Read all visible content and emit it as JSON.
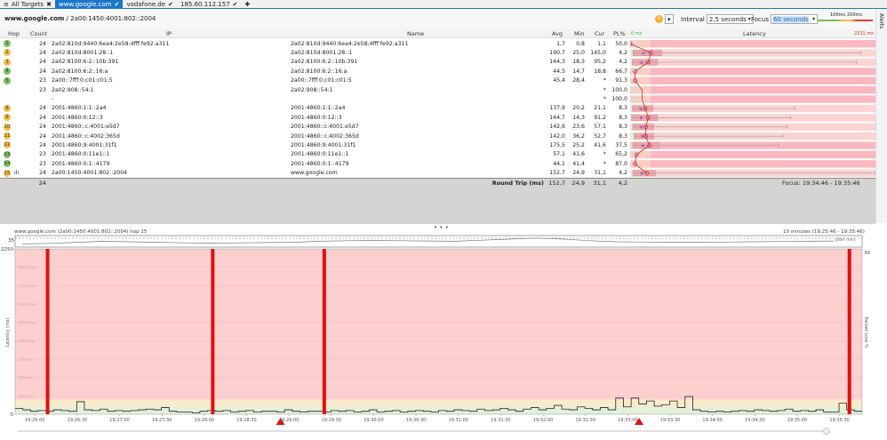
{
  "tabs": [
    {
      "label": "All Targets",
      "icon": "list-icon"
    },
    {
      "label": "www.google.com",
      "active": true
    },
    {
      "label": "vodafone.de"
    },
    {
      "label": "185.60.112.157"
    }
  ],
  "breadcrumb": {
    "host": "www.google.com",
    "path": "/ 2a00:1450:4001:802::2004"
  },
  "toolbar": {
    "interval_label": "Interval",
    "interval_value": "2,5 seconds",
    "focus_label": "Focus",
    "focus_value": "60 seconds",
    "scale_100": "100ms",
    "scale_200": "200ms",
    "alerts": "Alerts"
  },
  "columns": {
    "hop": "Hop",
    "count": "Count",
    "ip": "IP",
    "name": "Name",
    "avg": "Avg",
    "min": "Min",
    "cur": "Cur",
    "pl": "PL%",
    "latency": "Latency",
    "lat_min": "0 ms",
    "lat_max": "2231 ms"
  },
  "rows": [
    {
      "hop": "1",
      "status": "green",
      "count": "24",
      "ip": "2a02:810d:9440:6ea4:2e58:4fff:fe92:a311",
      "name": "2a02:810d:9440:6ea4:2e58:4fff:fe92:a311",
      "avg": "1,7",
      "min": "0,8",
      "cur": "1,1",
      "pl": "50,0",
      "a": 1.7,
      "mn": 0.8,
      "mx": 0,
      "plv": 50
    },
    {
      "hop": "2",
      "status": "orange",
      "count": "24",
      "ip": "2a02:810d:8001:28::1",
      "name": "2a02:810d:8001:28::1",
      "avg": "190,7",
      "min": "25,0",
      "cur": "145,0",
      "pl": "4,2",
      "a": 190.7,
      "mn": 25,
      "mx": 2100,
      "plv": 4.2
    },
    {
      "hop": "3",
      "status": "orange",
      "count": "24",
      "ip": "2a02:8100:6:2::10b:391",
      "name": "2a02:8100:6:2::10b:391",
      "avg": "164,3",
      "min": "18,3",
      "cur": "95,2",
      "pl": "4,2",
      "a": 164.3,
      "mn": 18.3,
      "mx": 2060,
      "plv": 4.2
    },
    {
      "hop": "4",
      "status": "green",
      "count": "24",
      "ip": "2a02:8100:6:2::16:a",
      "name": "2a02:8100:6:2::16:a",
      "avg": "44,5",
      "min": "14,7",
      "cur": "18,8",
      "pl": "66,7",
      "a": 44.5,
      "mn": 14.7,
      "mx": 0,
      "plv": 66.7
    },
    {
      "hop": "5",
      "status": "green",
      "count": "23",
      "ip": "2a00::7fff:0:c01:c01:5",
      "name": "2a00::7fff:0:c01:c01:5",
      "avg": "45,4",
      "min": "28,4",
      "cur": "*",
      "pl": "91,3",
      "a": 45.4,
      "mn": 28.4,
      "mx": 0,
      "plv": 91.3
    },
    {
      "hop": "",
      "status": "",
      "count": "23",
      "ip": "2a02:908::54:1",
      "name": "2a02:908::54:1",
      "avg": "",
      "min": "",
      "cur": "*",
      "pl": "100,0",
      "a": 0,
      "mn": 0,
      "mx": 0,
      "plv": 100
    },
    {
      "hop": "",
      "status": "",
      "count": "",
      "ip": "-",
      "name": "",
      "avg": "",
      "min": "",
      "cur": "*",
      "pl": "100,0",
      "a": 0,
      "mn": 0,
      "mx": 0,
      "plv": 100
    },
    {
      "hop": "8",
      "status": "orange",
      "count": "24",
      "ip": "2001:4860:1:1::2a4",
      "name": "2001:4860:1:1::2a4",
      "avg": "137,9",
      "min": "20,2",
      "cur": "21,1",
      "pl": "8,3",
      "a": 137.9,
      "mn": 20.2,
      "mx": 1500,
      "plv": 8.3
    },
    {
      "hop": "9",
      "status": "orange",
      "count": "24",
      "ip": "2001:4860:0:12::3",
      "name": "2001:4860:0:12::3",
      "avg": "164,7",
      "min": "14,3",
      "cur": "91,2",
      "pl": "8,3",
      "a": 164.7,
      "mn": 14.3,
      "mx": 1460,
      "plv": 8.3
    },
    {
      "hop": "10",
      "status": "orange",
      "count": "24",
      "ip": "2001:4860::c:4001:e5d7",
      "name": "2001:4860::c:4001:e5d7",
      "avg": "142,6",
      "min": "23,6",
      "cur": "57,1",
      "pl": "8,3",
      "a": 142.6,
      "mn": 23.6,
      "mx": 1430,
      "plv": 8.3
    },
    {
      "hop": "11",
      "status": "orange",
      "count": "24",
      "ip": "2001:4860::c:4002:365d",
      "name": "2001:4860::c:4002:365d",
      "avg": "142,0",
      "min": "36,2",
      "cur": "52,7",
      "pl": "8,3",
      "a": 142,
      "mn": 36.2,
      "mx": 1390,
      "plv": 8.3
    },
    {
      "hop": "12",
      "status": "orange",
      "count": "24",
      "ip": "2001:4860:9:4001:31f1",
      "name": "2001:4860:9:4001:31f1",
      "avg": "175,5",
      "min": "25,2",
      "cur": "41,6",
      "pl": "37,5",
      "a": 175.5,
      "mn": 25.2,
      "mx": 1350,
      "plv": 37.5
    },
    {
      "hop": "13",
      "status": "green",
      "count": "23",
      "ip": "2001:4860:0:11e1::1",
      "name": "2001:4860:0:11e1::1",
      "avg": "57,1",
      "min": "41,6",
      "cur": "*",
      "pl": "65,2",
      "a": 57.1,
      "mn": 41.6,
      "mx": 0,
      "plv": 65.2
    },
    {
      "hop": "14",
      "status": "green",
      "count": "23",
      "ip": "2001:4860:0:1::4179",
      "name": "2001:4860:0:1::4179",
      "avg": "44,1",
      "min": "41,4",
      "cur": "*",
      "pl": "87,0",
      "a": 44.1,
      "mn": 41.4,
      "mx": 0,
      "plv": 87
    },
    {
      "hop": "15",
      "status": "orange",
      "count": "24",
      "ip": "2a00:1450:4001:802::2004",
      "name": "www.google.com",
      "avg": "152,7",
      "min": "24,9",
      "cur": "31,1",
      "pl": "4,2",
      "a": 152.7,
      "mn": 24.9,
      "mx": 2230,
      "plv": 4.2
    }
  ],
  "roundtrip": {
    "count": "24",
    "label": "Round Trip (ms)",
    "avg": "152,7",
    "min": "24,9",
    "cur": "31,1",
    "pl": "4,2",
    "focus": "Focus: 19:34:46 - 19:35:46"
  },
  "colors": {
    "green": "#6ab04c",
    "orange": "#f0b030",
    "pink": "#fdd0d0",
    "red": "#e01010"
  },
  "chart_data": {
    "type": "line",
    "title": "www.google.com (2a00:1450:4001:802::2004) hop 15",
    "range_label": "10 minutes (19:25:46 - 19:35:46)",
    "jitter_label": "Jitter (ms)",
    "jitter_max": "35",
    "ylabel": "Latency (ms)",
    "y2label": "Packet Loss %",
    "y2max": "30",
    "ylim": [
      0,
      2250
    ],
    "yticks": [
      "2250",
      "2000 ms",
      "1750 ms",
      "1500 ms",
      "1250 ms",
      "1000 ms",
      "750 ms",
      "500 ms",
      "250 ms",
      "0"
    ],
    "xticks": [
      "19:26:00",
      "19:26:30",
      "19:27:00",
      "19:27:30",
      "19:28:00",
      "19:28:30",
      "19:29:00",
      "19:29:30",
      "19:30:00",
      "19:30:30",
      "19:31:00",
      "19:31:30",
      "19:32:00",
      "19:32:30",
      "19:33:00",
      "19:33:30",
      "19:34:00",
      "19:34:30",
      "19:35:00",
      "19:35:30"
    ],
    "x_start_sec": -14,
    "x_end_sec": 586,
    "loss_seconds": [
      9,
      126,
      205,
      577
    ],
    "alert_seconds": [
      174,
      428
    ],
    "latency_ms": [
      80,
      60,
      40,
      50,
      40,
      60,
      50,
      40,
      170,
      60,
      50,
      70,
      40,
      50,
      40,
      50,
      60,
      70,
      60,
      90,
      40,
      30,
      30,
      20,
      40,
      50,
      40,
      50,
      30,
      40,
      50,
      30,
      40,
      40,
      30,
      60,
      40,
      30,
      40,
      40,
      30,
      50,
      40,
      50,
      30,
      40,
      60,
      30,
      40,
      50,
      30,
      40,
      50,
      40,
      30,
      50,
      40,
      60,
      50,
      40,
      70,
      50,
      60,
      80,
      60,
      40,
      70,
      90,
      60,
      80,
      120,
      70,
      60,
      100,
      80,
      60,
      90,
      60,
      220,
      100,
      220,
      140,
      180,
      110,
      130,
      180,
      90,
      240,
      60,
      40,
      30,
      40,
      30,
      40,
      50,
      40,
      60,
      50,
      40,
      50,
      70,
      40,
      50,
      40,
      60,
      30,
      30,
      150,
      60,
      40
    ],
    "jitter_ms": [
      12,
      14,
      18,
      22,
      20,
      18,
      16,
      15,
      16,
      17,
      18,
      22,
      24,
      25,
      24,
      23,
      22,
      26,
      30,
      34,
      30,
      24,
      20,
      19,
      18,
      18,
      19,
      20,
      21,
      22,
      23
    ]
  }
}
